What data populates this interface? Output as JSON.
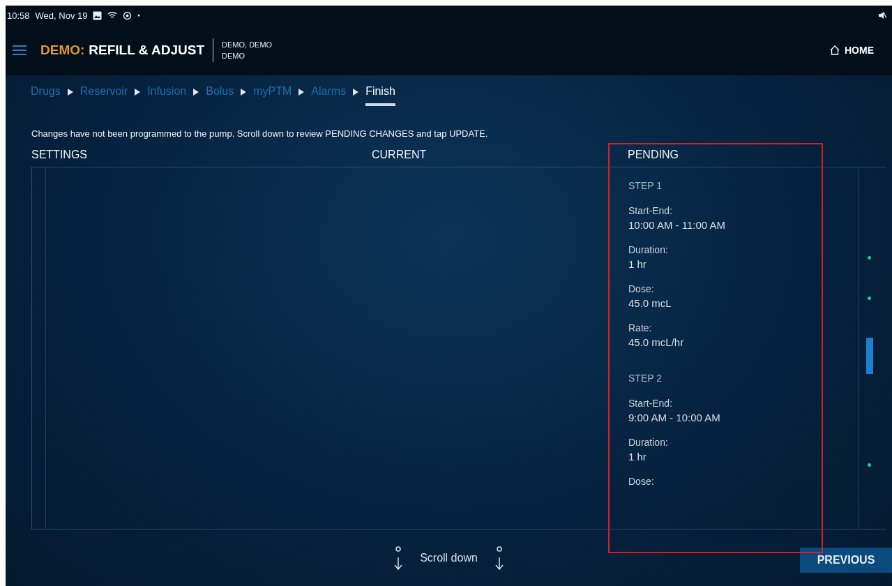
{
  "status_bar": {
    "time": "10:58",
    "date": "Wed, Nov 19"
  },
  "header": {
    "prefix": "DEMO:",
    "title": "REFILL & ADJUST",
    "patient_name": "DEMO, DEMO",
    "patient_id": "DEMO",
    "home": "HOME"
  },
  "breadcrumbs": [
    {
      "label": "Drugs",
      "selected": false
    },
    {
      "label": "Reservoir",
      "selected": false
    },
    {
      "label": "Infusion",
      "selected": false
    },
    {
      "label": "Bolus",
      "selected": false
    },
    {
      "label": "myPTM",
      "selected": false
    },
    {
      "label": "Alarms",
      "selected": false
    },
    {
      "label": "Finish",
      "selected": true
    }
  ],
  "notice": "Changes have not been programmed to the pump. Scroll down to review PENDING CHANGES and tap UPDATE.",
  "columns": [
    "SETTINGS",
    "CURRENT",
    "PENDING"
  ],
  "pending_steps": [
    {
      "title": "STEP 1",
      "fields": [
        {
          "label": "Start-End:",
          "value": "10:00 AM - 11:00 AM"
        },
        {
          "label": "Duration:",
          "value": "1 hr"
        },
        {
          "label": "Dose:",
          "value": "45.0 mcL"
        },
        {
          "label": "Rate:",
          "value": "45.0 mcL/hr"
        }
      ]
    },
    {
      "title": "STEP 2",
      "fields": [
        {
          "label": "Start-End:",
          "value": "9:00 AM - 10:00 AM"
        },
        {
          "label": "Duration:",
          "value": "1 hr"
        },
        {
          "label": "Dose:"
        }
      ]
    }
  ],
  "scroll_hint": "Scroll down",
  "previous_button": "PREVIOUS"
}
